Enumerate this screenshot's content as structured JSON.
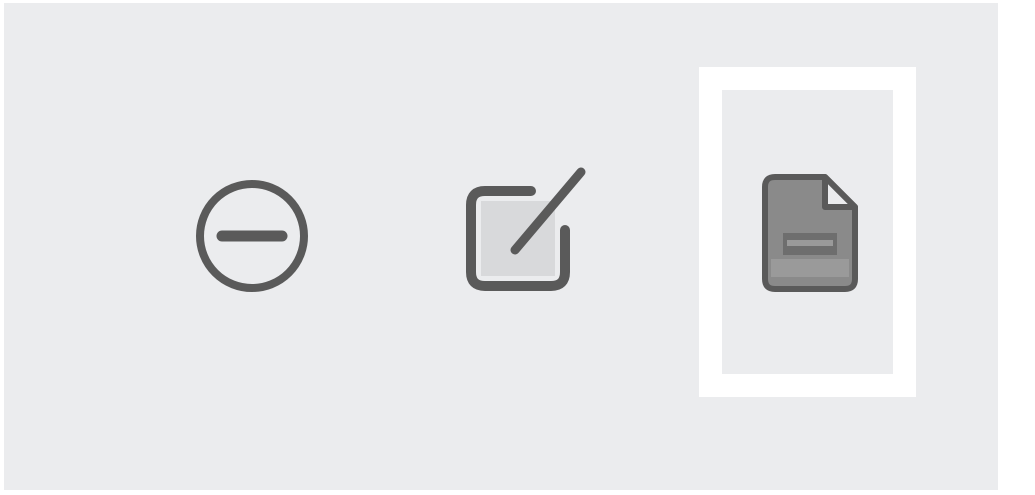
{
  "toolbar": {
    "buttons": [
      {
        "id": "remove",
        "icon": "minus-circle-icon",
        "state": "normal"
      },
      {
        "id": "edit",
        "icon": "edit-pencil-icon",
        "state": "normal"
      },
      {
        "id": "document",
        "icon": "document-icon",
        "state": "focused"
      }
    ]
  },
  "colors": {
    "toolbar_background": "#ebecee",
    "icon_stroke": "#5a5a5a",
    "icon_fill_dark": "#6e6e6e",
    "icon_fill_light": "#9a9a9a",
    "focus_outline": "#ffffff"
  }
}
